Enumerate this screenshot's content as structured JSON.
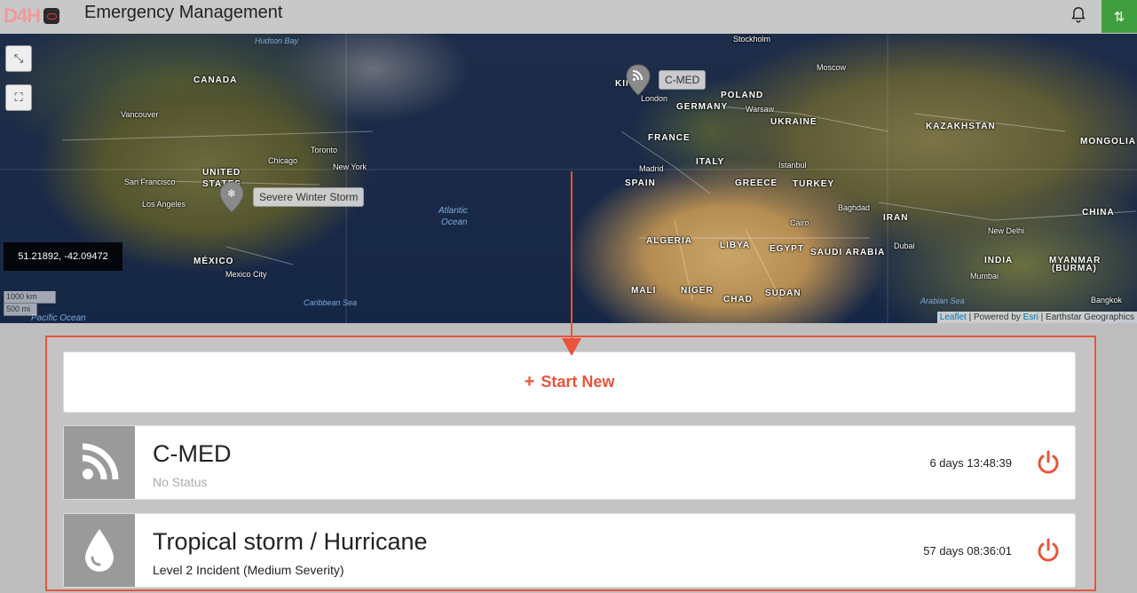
{
  "app": {
    "logo_text": "D4H",
    "title": "Emergency Management"
  },
  "header": {
    "bell_icon": "bell-icon",
    "sort_icon": "sort-arrows-icon"
  },
  "map": {
    "coords_readout": "51.21892, -42.09472",
    "scale": {
      "km": "1000 km",
      "mi": "500 mi"
    },
    "attribution": {
      "leaflet": "Leaflet",
      "powered": " | Powered by ",
      "esri": "Esri",
      "rest": " | Earthstar Geographics"
    },
    "labels": {
      "hudson_bay": "Hudson Bay",
      "canada": "CANADA",
      "vancouver": "Vancouver",
      "toronto": "Toronto",
      "chicago": "Chicago",
      "new_york": "New York",
      "united_states_1": "UNITED",
      "united_states_2": "STATES",
      "san_francisco": "San Francisco",
      "los_angeles": "Los Angeles",
      "mexico": "MÉXICO",
      "mexico_city": "Mexico City",
      "caribbean": "Caribbean Sea",
      "pacific": "Pacific Ocean",
      "atlantic_1": "Atlantic",
      "atlantic_2": "Ocean",
      "stockholm": "Stockholm",
      "moscow": "Moscow",
      "kingdom": "KIN",
      "london": "London",
      "poland": "POLAND",
      "germany": "GERMANY",
      "warsaw": "Warsaw",
      "ukraine": "UKRAINE",
      "kazakhstan": "KAZAKHSTAN",
      "mongolia": "MONGOLIA",
      "france": "FRANCE",
      "italy": "ITALY",
      "madrid": "Madrid",
      "spain": "SPAIN",
      "istanbul": "Istanbul",
      "greece": "GREECE",
      "turkey": "TURKEY",
      "baghdad": "Baghdad",
      "iran": "IRAN",
      "china": "CHINA",
      "algeria": "ALGERIA",
      "libya": "LIBYA",
      "egypt": "EGYPT",
      "cairo": "Cairo",
      "saudi": "SAUDI ARABIA",
      "dubai": "Dubai",
      "new_delhi": "New Delhi",
      "india": "INDIA",
      "myanmar_1": "MYANMAR",
      "myanmar_2": "(BURMA)",
      "mali": "MALI",
      "niger": "NIGER",
      "chad": "CHAD",
      "sudan": "SUDAN",
      "arabian_sea": "Arabian Sea",
      "mumbai": "Mumbai",
      "bangkok": "Bangkok"
    },
    "markers": [
      {
        "label": "Severe Winter Storm",
        "icon": "snowflake-icon"
      },
      {
        "label": "C-MED",
        "icon": "rss-feed-icon"
      }
    ]
  },
  "panel": {
    "start_new": {
      "plus": "+",
      "label": "Start New"
    },
    "incidents": [
      {
        "title": "C-MED",
        "status": "No Status",
        "duration": "6 days 13:48:39",
        "icon": "rss-feed-icon",
        "status_color": "#aaaaaa"
      },
      {
        "title": "Tropical storm / Hurricane",
        "status": "Level 2 Incident (Medium Severity)",
        "duration": "57 days 08:36:01",
        "icon": "water-drop-icon",
        "status_color": "#222222"
      }
    ]
  },
  "colors": {
    "accent": "#e8553a",
    "green": "#3f9f3f",
    "icon_bg": "#9a9a9a"
  }
}
